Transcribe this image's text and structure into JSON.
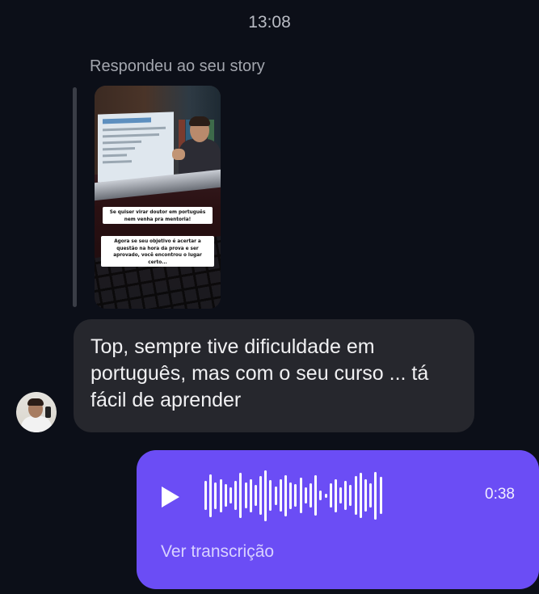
{
  "conversation": {
    "timestamp": "13:08"
  },
  "story_reply": {
    "label": "Respondeu ao seu story",
    "caption_1": "Se quiser virar doutor em português nem venha pra mentoria!",
    "caption_2": "Agora se seu objetivo é acertar a questão na hora da prova e ser aprovado, você encontrou o lugar certo..."
  },
  "received_message": {
    "text": "Top, sempre tive dificuldade em português, mas com o seu curso ... tá fácil de aprender"
  },
  "voice_message": {
    "duration": "0:38",
    "transcript_label": "Ver transcrição",
    "waveform_levels": [
      0.55,
      0.8,
      0.5,
      0.62,
      0.42,
      0.3,
      0.55,
      0.85,
      0.48,
      0.62,
      0.4,
      0.72,
      0.95,
      0.58,
      0.35,
      0.6,
      0.78,
      0.5,
      0.42,
      0.66,
      0.3,
      0.45,
      0.75,
      0.18,
      0.08,
      0.45,
      0.62,
      0.3,
      0.55,
      0.4,
      0.72,
      0.85,
      0.6,
      0.45,
      0.9,
      0.7
    ]
  },
  "colors": {
    "background": "#0c0f18",
    "received_bubble": "#26272d",
    "sent_bubble": "#6b4df5"
  }
}
